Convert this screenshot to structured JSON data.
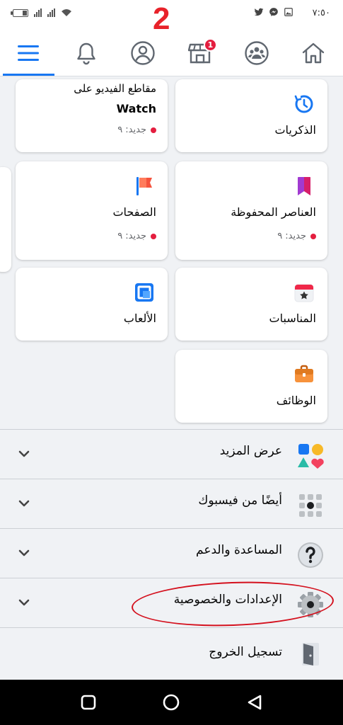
{
  "status_bar": {
    "time": "٧:٥٠"
  },
  "annotation": {
    "step_number": "2"
  },
  "nav": {
    "marketplace_badge": "1",
    "tabs": [
      "menu",
      "notifications",
      "profile",
      "marketplace",
      "groups",
      "home"
    ]
  },
  "cards": {
    "watch": {
      "line1": "مقاطع الفيديو على",
      "line2": "Watch",
      "sub": "جديد: ٩"
    },
    "memories": {
      "label": "الذكريات"
    },
    "pages": {
      "label": "الصفحات",
      "sub": "جديد: ٩"
    },
    "saved": {
      "label": "العناصر المحفوظة",
      "sub": "جديد: ٩"
    },
    "games": {
      "label": "الألعاب"
    },
    "events": {
      "label": "المناسبات"
    },
    "jobs": {
      "label": "الوظائف"
    }
  },
  "rows": {
    "see_more": "عرض المزيد",
    "also_from_facebook": "أيضًا من فيسبوك",
    "help_support": "المساعدة والدعم",
    "settings_privacy": "الإعدادات والخصوصية",
    "logout": "تسجيل الخروج"
  },
  "colors": {
    "accent": "#1877f2",
    "badge": "#e41e3f",
    "annotation_red": "#e8222a"
  }
}
